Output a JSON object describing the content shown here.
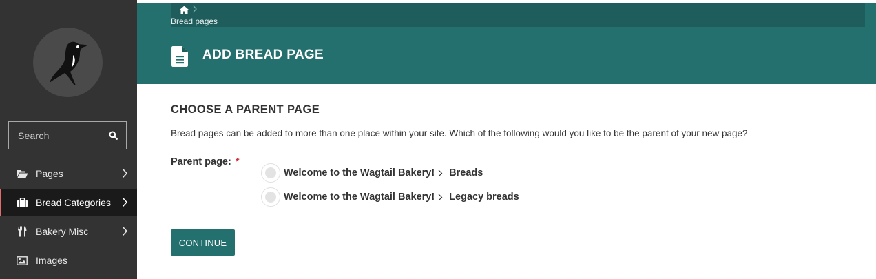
{
  "sidebar": {
    "search_placeholder": "Search",
    "items": [
      {
        "label": "Pages"
      },
      {
        "label": "Bread Categories"
      },
      {
        "label": "Bakery Misc"
      },
      {
        "label": "Images"
      }
    ]
  },
  "header": {
    "breadcrumb": "Bread pages",
    "title": "ADD BREAD PAGE"
  },
  "main": {
    "section_title": "CHOOSE A PARENT PAGE",
    "help_text": "Bread pages can be added to more than one place within your site. Which of the following would you like to be the parent of your new page?",
    "field_label": "Parent page:",
    "required_marker": "*",
    "options": [
      {
        "parent": "Welcome to the Wagtail Bakery!",
        "child": "Breads"
      },
      {
        "parent": "Welcome to the Wagtail Bakery!",
        "child": "Legacy breads"
      }
    ],
    "continue_label": "CONTINUE"
  },
  "colors": {
    "sidebar": "#333333",
    "accent_teal": "#24706f",
    "breadcrumb_bar": "#1e5d5c",
    "required_red": "#cd3238"
  }
}
